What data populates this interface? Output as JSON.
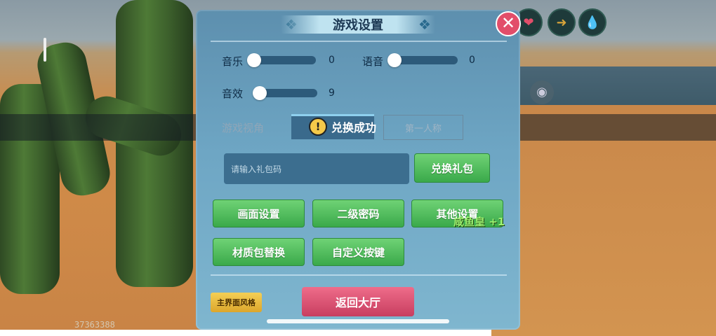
{
  "dialog": {
    "title": "游戏设置",
    "close_label": "✕"
  },
  "settings": {
    "music": {
      "label": "音乐",
      "value": "0",
      "level": 0
    },
    "voice": {
      "label": "语音",
      "value": "0",
      "level": 0
    },
    "sfx": {
      "label": "音效",
      "value": "9",
      "level": 0.09
    }
  },
  "view": {
    "label": "游戏视角",
    "options": [
      "第一人称"
    ]
  },
  "toast": {
    "icon": "!",
    "text": "兑换成功"
  },
  "gift": {
    "placeholder": "请输入礼包码",
    "redeem_label": "兑换礼包"
  },
  "buttons": {
    "graphics": "画面设置",
    "secondary_password": "二级密码",
    "other": "其他设置",
    "texture_pack": "材质包替换",
    "custom_keys": "自定义按键",
    "ui_style": "主界面风格",
    "back_lobby": "返回大厅"
  },
  "pickup": {
    "text": "咸鱼皇 +1"
  },
  "hud": {
    "icons": [
      "heart-icon",
      "food-icon",
      "water-icon"
    ],
    "colors": {
      "heart": "#e24e6a",
      "food": "#d8a43a",
      "water": "#3fb0a0"
    }
  },
  "player_id": "37363388"
}
